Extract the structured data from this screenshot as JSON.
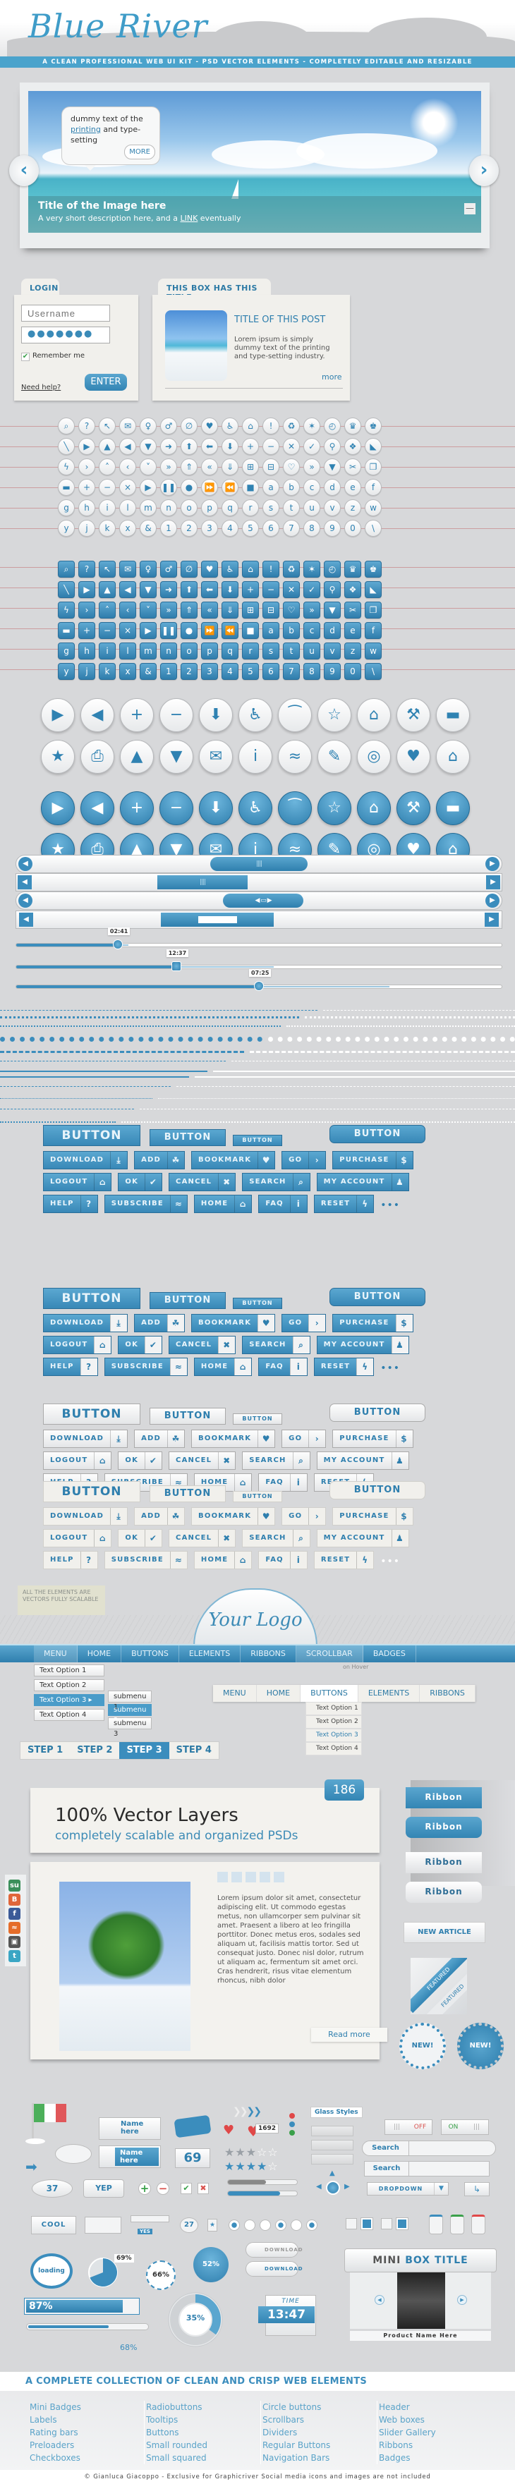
{
  "header": {
    "logo": "Blue River",
    "tagline": "A CLEAN PROFESSIONAL WEB UI KIT - PSD VECTOR ELEMENTS - COMPLETELY EDITABLE AND RESIZABLE"
  },
  "slider": {
    "bubble_text_1": "dummy text of the",
    "bubble_link": "printing",
    "bubble_text_2": " and type-setting",
    "bubble_more": "MORE",
    "caption_title": "Title of the Image here",
    "caption_desc_1": "A very short description here, and a ",
    "caption_link": "LINK",
    "caption_desc_2": " eventually",
    "prev_icon": "chevron-left-icon",
    "next_icon": "chevron-right-icon",
    "minimize": "—"
  },
  "login": {
    "tab": "LOGIN",
    "username_placeholder": "Username",
    "password_value": "●●●●●●●",
    "remember": "Remember me",
    "remember_checked": true,
    "help": "Need help?",
    "enter": "ENTER"
  },
  "post_box": {
    "tab": "THIS BOX HAS THIS TITLE",
    "title": "TITLE OF THIS POST",
    "text": "Lorem ipsum is simply dummy text of the printing and type-setting industry.",
    "more": "more"
  },
  "icon_rows": [
    [
      "⌕",
      "?",
      "↖",
      "✉",
      "♀",
      "♂",
      "∅",
      "♥",
      "♿",
      "⌂",
      "!",
      "♻",
      "✶",
      "◴",
      "♛",
      "♚"
    ],
    [
      "╲",
      "▶",
      "▲",
      "◀",
      "▼",
      "➜",
      "⬆",
      "⬅",
      "⬇",
      "+",
      "−",
      "✕",
      "✓",
      "⚲",
      "❖",
      "◣"
    ],
    [
      "ϟ",
      "›",
      "˄",
      "‹",
      "˅",
      "»",
      "⇑",
      "«",
      "⇓",
      "⊞",
      "⊟",
      "♡",
      "»",
      "▼",
      "✂",
      "❐"
    ],
    [
      "▬",
      "+",
      "−",
      "×",
      "▶",
      "❚❚",
      "●",
      "⏩",
      "⏪",
      "■",
      "a",
      "b",
      "c",
      "d",
      "e",
      "f"
    ],
    [
      "g",
      "h",
      "i",
      "l",
      "m",
      "n",
      "o",
      "p",
      "q",
      "r",
      "s",
      "t",
      "u",
      "v",
      "z",
      "w"
    ],
    [
      "y",
      "j",
      "k",
      "x",
      "&",
      "1",
      "2",
      "3",
      "4",
      "5",
      "6",
      "7",
      "8",
      "9",
      "0",
      "\\"
    ]
  ],
  "big_icon_rows": [
    [
      "▶",
      "◀",
      "+",
      "−",
      "⬇",
      "♿",
      "⁀",
      "☆",
      "⌂",
      "⚒",
      "▬"
    ],
    [
      "★",
      "⎙",
      "▲",
      "▼",
      "✉",
      "i",
      "≈",
      "✎",
      "◎",
      "♥",
      "⌂"
    ]
  ],
  "scrollbars": {
    "slider_labels": [
      "02:41",
      "12:37",
      "07:25"
    ],
    "slider_values": [
      0.21,
      0.33,
      0.5
    ],
    "buffer_values": [
      0.23,
      0.53,
      0.77
    ]
  },
  "buttons": {
    "big": "BUTTON",
    "medium": "BUTTON",
    "small": "BUTTON",
    "rounded": "BUTTON",
    "row1": [
      {
        "label": "DOWNLOAD",
        "icon": "⤓"
      },
      {
        "label": "ADD",
        "icon": "☘"
      },
      {
        "label": "BOOKMARK",
        "icon": "♥"
      },
      {
        "label": "GO",
        "icon": "›"
      },
      {
        "label": "PURCHASE",
        "icon": "$"
      }
    ],
    "row2": [
      {
        "label": "LOGOUT",
        "icon": "⌂"
      },
      {
        "label": "OK",
        "icon": "✔"
      },
      {
        "label": "CANCEL",
        "icon": "✖"
      },
      {
        "label": "SEARCH",
        "icon": "⌕"
      },
      {
        "label": "MY ACCOUNT",
        "icon": "♟"
      }
    ],
    "row3": [
      {
        "label": "HELP",
        "icon": "?"
      },
      {
        "label": "SUBSCRIBE",
        "icon": "≈"
      },
      {
        "label": "HOME",
        "icon": "⌂"
      },
      {
        "label": "FAQ",
        "icon": "i"
      },
      {
        "label": "RESET",
        "icon": "ϟ"
      }
    ],
    "more": "•••"
  },
  "note": "ALL THE ELEMENTS ARE VECTORS FULLY SCALABLE",
  "your_logo": "Your Logo",
  "nav": {
    "items": [
      "MENU",
      "HOME",
      "BUTTONS",
      "ELEMENTS",
      "RIBBONS",
      "SCROLLBAR",
      "BADGES"
    ],
    "hover_note": "on Hover",
    "dropdown": [
      "Text Option 1",
      "Text Option 2",
      "Text Option 3 ▸",
      "Text Option 4"
    ],
    "submenu": [
      "submenu 1",
      "submenu 2",
      "submenu 3"
    ],
    "nav2_items": [
      "MENU",
      "HOME",
      "BUTTONS",
      "ELEMENTS",
      "RIBBONS"
    ],
    "nav2_dropdown": [
      "Text Option 1",
      "Text Option 2",
      "Text Option 3",
      "Text Option 4"
    ],
    "steps": [
      "STEP 1",
      "STEP 2",
      "STEP 3",
      "STEP 4"
    ]
  },
  "banner": {
    "count": "186",
    "title": "100% Vector Layers",
    "subtitle": "completely scalable and organized PSDs"
  },
  "ribbons": [
    "Ribbon",
    "Ribbon",
    "Ribbon",
    "Ribbon"
  ],
  "new_article": "NEW ARTICLE",
  "featured": "FEATURED",
  "new_badge": "NEW!",
  "article": {
    "text": "Lorem ipsum dolor sit amet, consectetur adipiscing elit. Ut commodo egestas metus, non ullamcorper sem pulvinar sit amet. Praesent a libero at leo fringilla porttitor. Donec metus eros, sodales sed aliquam ut, facilisis mattis tortor. Sed ut consequat justo. Donec nisl dolor, rutrum ut aliquam ac, fermentum sit amet orci. Cras hendrerit, risus vitae elementum rhoncus, nibh dolor",
    "read_more": "Read more"
  },
  "social_icons": [
    {
      "name": "stumbleupon-icon",
      "glyph": "su",
      "color": "#3a8f5a"
    },
    {
      "name": "blogger-icon",
      "glyph": "B",
      "color": "#e0663a"
    },
    {
      "name": "facebook-icon",
      "glyph": "f",
      "color": "#3b5a98"
    },
    {
      "name": "rss-icon",
      "glyph": "≈",
      "color": "#e56d2a"
    },
    {
      "name": "delicious-icon",
      "glyph": "▣",
      "color": "#555555"
    },
    {
      "name": "twitter-icon",
      "glyph": "t",
      "color": "#3aa6c4"
    }
  ],
  "widgets": {
    "name_here": "Name here",
    "likes": "1692",
    "count": "69",
    "bubble_37": "37",
    "yep": "YEP",
    "glass_styles": "Glass Styles",
    "off": "OFF",
    "on": "ON",
    "search": "Search",
    "dropdown": "DROPDOWN",
    "cool": "COOL",
    "yes": "YES",
    "pin_27": "27",
    "download": "DOWNLOAD",
    "loading": "loading",
    "pie_pct": "69%",
    "ring_pct": "66%",
    "ball_pct": "52%",
    "donut_pct": "35%",
    "bar_pct": "87%",
    "thin_bar_pct": "68%",
    "time_label": "TIME",
    "time_value": "13:47",
    "mini_box_title_1": "MINI",
    "mini_box_title_2": "BOX TITLE",
    "product_name": "Product Name Here",
    "rating_grey": 2.5,
    "rating_blue": 3.5,
    "rating_max": 5,
    "pie_value": 0.69,
    "donut_value": 0.35,
    "bar_value": 0.87,
    "thin_bar_value": 0.68
  },
  "footer": {
    "headline": "A COMPLETE COLLECTION OF CLEAN AND CRISP WEB ELEMENTS",
    "columns": [
      [
        "Mini Badges",
        "Labels",
        "Rating bars",
        "Preloaders",
        "Checkboxes"
      ],
      [
        "Radiobuttons",
        "Tooltips",
        "Buttons",
        "Small rounded",
        "Small squared"
      ],
      [
        "Circle buttons",
        "Scrollbars",
        "Dividers",
        "Regular Buttons",
        "Navigation Bars"
      ],
      [
        "Header",
        "Web boxes",
        "Slider Gallery",
        "Ribbons",
        "Badges"
      ]
    ],
    "copyright": "© Gianluca Giacoppo - Exclusive for Graphicriver  Social media icons and images are not included"
  }
}
